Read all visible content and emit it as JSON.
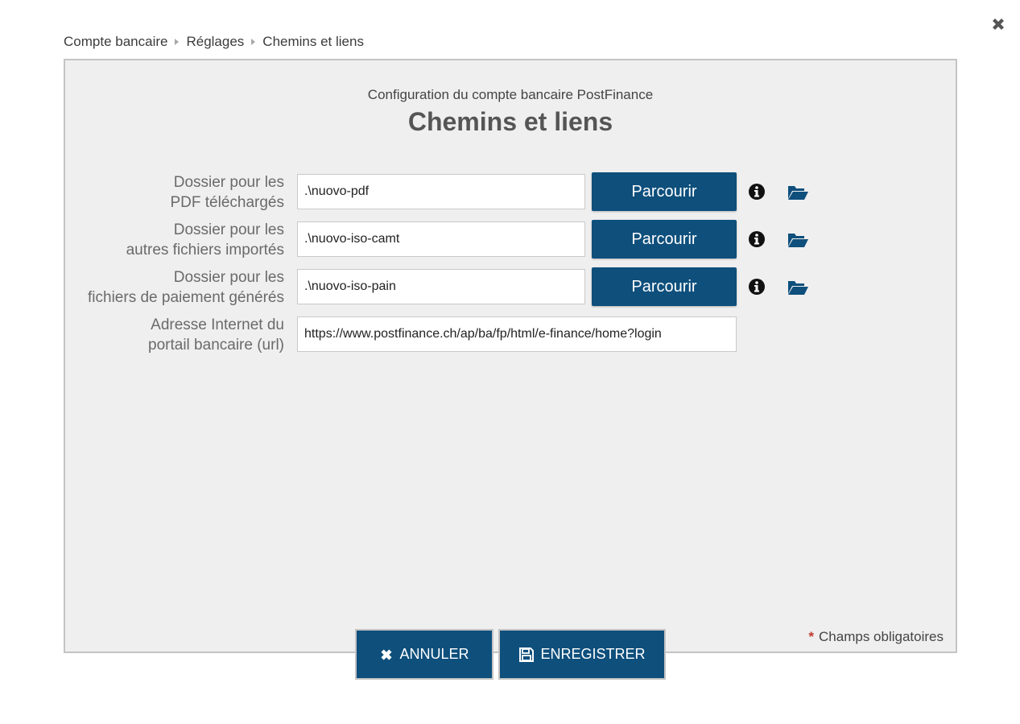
{
  "breadcrumb": [
    "Compte bancaire",
    "Réglages",
    "Chemins et liens"
  ],
  "header": {
    "subtitle": "Configuration du compte bancaire PostFinance",
    "title": "Chemins et liens"
  },
  "fields": [
    {
      "label_line1": "Dossier pour les",
      "label_line2": "PDF téléchargés",
      "value": ".\\nuovo-pdf",
      "browse_label": "Parcourir"
    },
    {
      "label_line1": "Dossier pour les",
      "label_line2": "autres fichiers importés",
      "value": ".\\nuovo-iso-camt",
      "browse_label": "Parcourir"
    },
    {
      "label_line1": "Dossier pour les",
      "label_line2": "fichiers de paiement générés",
      "value": ".\\nuovo-iso-pain",
      "browse_label": "Parcourir"
    },
    {
      "label_line1": "Adresse Internet du",
      "label_line2": "portail bancaire (url)",
      "value": "https://www.postfinance.ch/ap/ba/fp/html/e-finance/home?login"
    }
  ],
  "required_note": {
    "star": "*",
    "text": "Champs obligatoires"
  },
  "buttons": {
    "cancel": "ANNULER",
    "save": "ENREGISTRER"
  },
  "icons": {
    "close": "close-icon",
    "info": "info-icon",
    "folder": "folder-open-icon",
    "cancel": "x-icon",
    "save": "floppy-disk-icon"
  },
  "colors": {
    "primary": "#0e4f7c",
    "panel_bg": "#efefef",
    "required_star": "#c0392b"
  }
}
